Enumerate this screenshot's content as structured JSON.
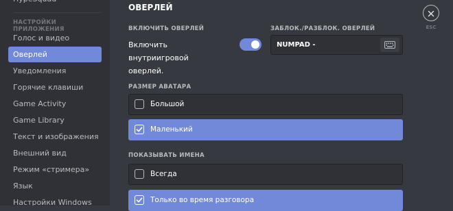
{
  "sidebar": {
    "items": [
      {
        "label": "HypeSquad"
      },
      {
        "label": "Голос и видео"
      },
      {
        "label": "Оверлей"
      },
      {
        "label": "Уведомления"
      },
      {
        "label": "Горячие клавиши"
      },
      {
        "label": "Game Activity"
      },
      {
        "label": "Game Library"
      },
      {
        "label": "Текст и изображения"
      },
      {
        "label": "Внешний вид"
      },
      {
        "label": "Режим «стримера»"
      },
      {
        "label": "Язык"
      },
      {
        "label": "Настройки Windows"
      }
    ],
    "section_header": "НАСТРОЙКИ ПРИЛОЖЕНИЯ",
    "active_label": "Оверлей"
  },
  "main": {
    "title": "ОВЕРЛЕЙ",
    "enable_overlay_label": "ВКЛЮЧИТЬ ОВЕРЛЕЙ",
    "toggle_text": "Включить внутриигровой оверлей.",
    "toggle_on": true,
    "lock_label": "ЗАБЛОК./РАЗБЛОК. ОВЕРЛЕЙ",
    "keybind_value": "NUMPAD -",
    "avatar_size_label": "РАЗМЕР АВАТАРА",
    "avatar_options": [
      {
        "label": "Большой",
        "checked": false
      },
      {
        "label": "Маленький",
        "checked": true
      }
    ],
    "show_names_label": "ПОКАЗЫВАТЬ ИМЕНА",
    "names_options": [
      {
        "label": "Всегда",
        "checked": false
      },
      {
        "label": "Только во время разговора",
        "checked": true
      }
    ],
    "close_label": "ESC"
  },
  "colors": {
    "accent": "#7289da",
    "background": "#36393f",
    "sidebar": "#2f3136"
  }
}
